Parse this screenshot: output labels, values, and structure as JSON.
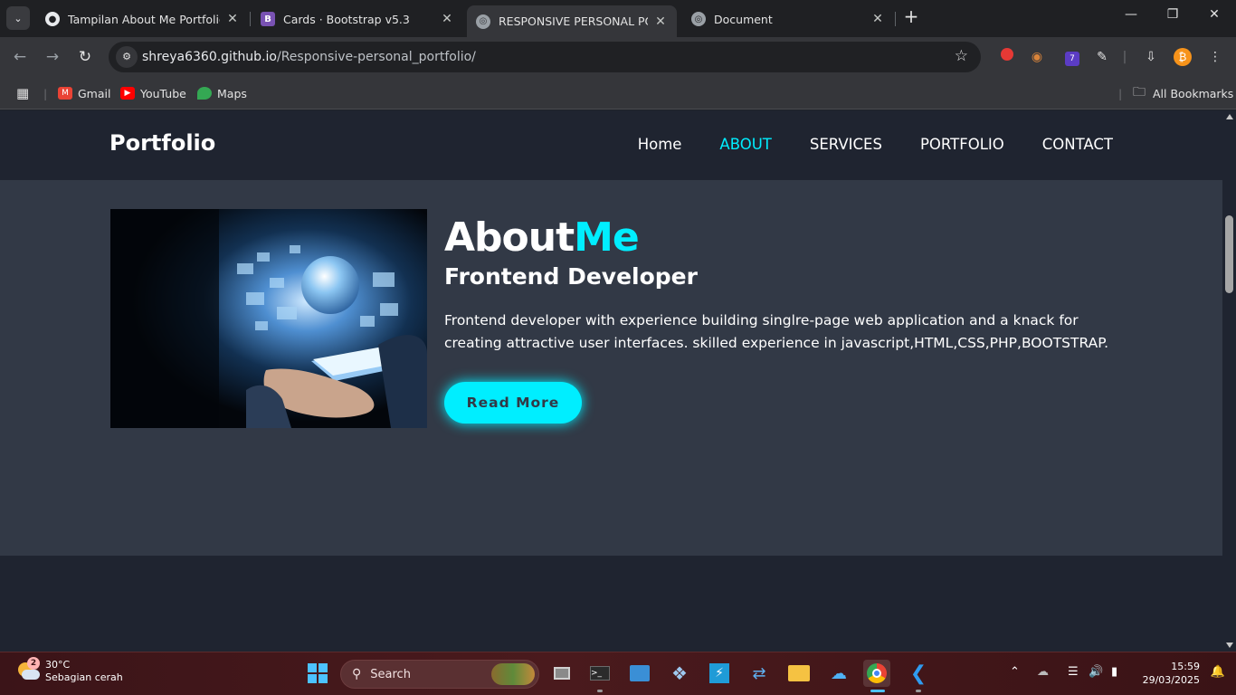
{
  "browser": {
    "tabs": [
      {
        "title": "Tampilan About Me Portfolio",
        "favicon": "github-icon"
      },
      {
        "title": "Cards · Bootstrap v5.3",
        "favicon": "bootstrap-icon"
      },
      {
        "title": "RESPONSIVE PERSONAL PORTF",
        "favicon": "globe-icon",
        "active": true
      },
      {
        "title": "Document",
        "favicon": "globe-icon"
      }
    ],
    "url_host": "shreya6360.github.io",
    "url_path": "/Responsive-personal_portfolio/",
    "bookmarks": [
      "Gmail",
      "YouTube",
      "Maps"
    ],
    "all_bookmarks": "All Bookmarks",
    "extension_badge": "7"
  },
  "site": {
    "logo": "Portfolio",
    "nav": [
      "Home",
      "ABOUT",
      "SERVICES",
      "PORTFOLIO",
      "CONTACT"
    ],
    "active_nav": "ABOUT",
    "about": {
      "heading_main": "About",
      "heading_accent": "Me",
      "subtitle": "Frontend Developer",
      "description": "Frontend developer with experience building singlre-page web application and a knack for creating attractive user interfaces. skilled experience in javascript,HTML,CSS,PHP,BOOTSTRAP.",
      "button": "Read More"
    },
    "accent_color": "#00eeff"
  },
  "taskbar": {
    "weather_temp": "30°C",
    "weather_desc": "Sebagian cerah",
    "weather_badge": "2",
    "search_label": "Search",
    "time": "15:59",
    "date": "29/03/2025"
  }
}
